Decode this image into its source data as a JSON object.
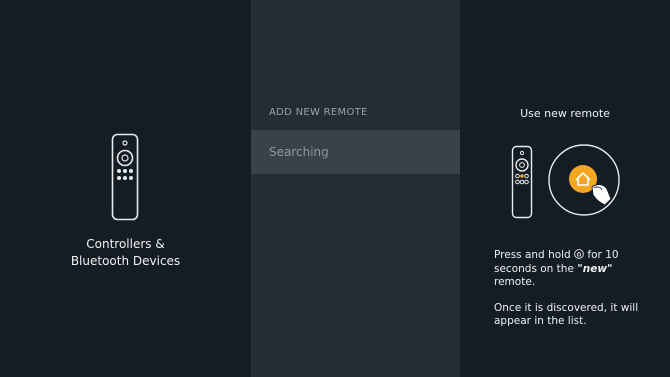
{
  "left_panel": {
    "caption_line1": "Controllers &",
    "caption_line2": "Bluetooth Devices",
    "icon": "remote-icon"
  },
  "middle_panel": {
    "section_title": "ADD NEW REMOTE",
    "items": [
      {
        "label": "Searching"
      }
    ]
  },
  "right_panel": {
    "title": "Use new remote",
    "instruction_part1": "Press and hold",
    "instruction_part2": "for 10 seconds on the",
    "instruction_emph": "\"new\"",
    "instruction_part3": "remote.",
    "instruction_2": "Once it is discovered, it will appear in the list.",
    "home_icon": "home-icon",
    "accent_color": "#f5a623"
  }
}
